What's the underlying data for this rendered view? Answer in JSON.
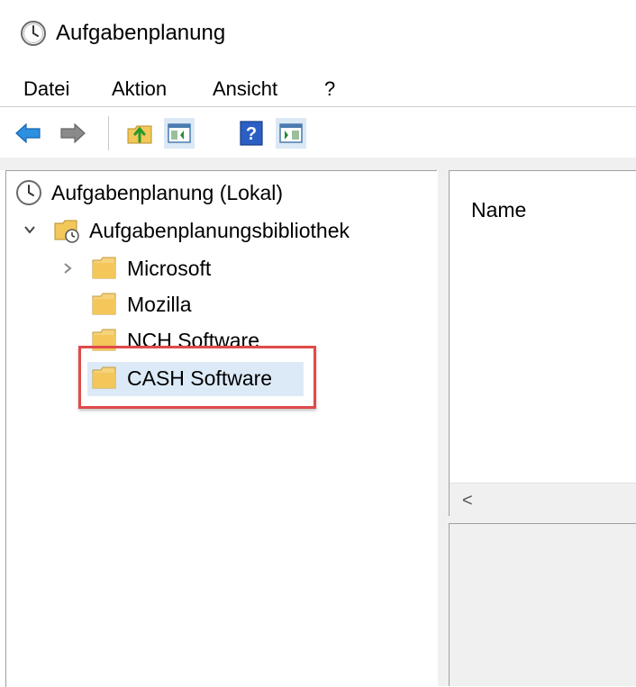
{
  "window": {
    "title": "Aufgabenplanung",
    "icon": "clock-icon"
  },
  "menu": [
    "Datei",
    "Aktion",
    "Ansicht",
    "?"
  ],
  "toolbar": {
    "buttons": [
      "back-arrow-icon",
      "forward-arrow-icon",
      "up-folder-icon",
      "show-hide-console-tree-icon",
      "help-icon",
      "show-hide-action-pane-icon"
    ]
  },
  "tree": {
    "root": "Aufgabenplanung (Lokal)",
    "library": "Aufgabenplanungsbibliothek",
    "folders": [
      "Microsoft",
      "Mozilla",
      "NCH Software",
      "CASH Software"
    ],
    "selected": "CASH Software"
  },
  "list": {
    "column_header": "Name",
    "scroll_left_glyph": "<"
  },
  "colors": {
    "highlight_border": "#e04a4a",
    "selection": "#dceaf8",
    "accent_blue": "#1f7fd8"
  }
}
